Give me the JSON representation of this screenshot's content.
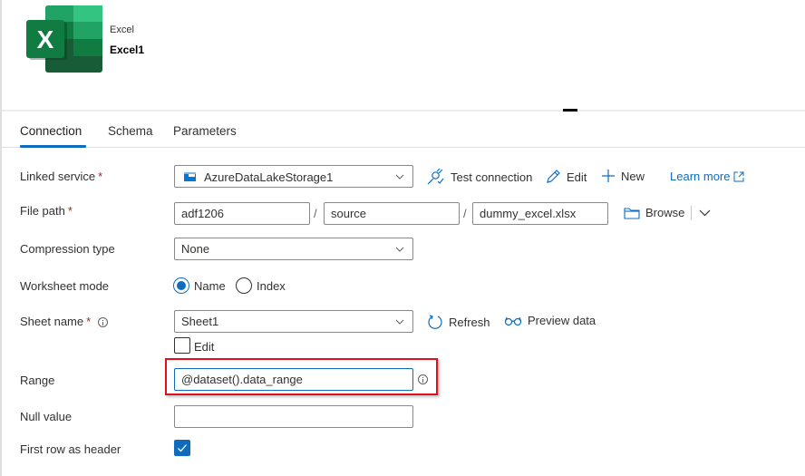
{
  "header": {
    "dataset_type": "Excel",
    "dataset_name": "Excel1",
    "icon": "excel-logo-icon"
  },
  "tabs": [
    {
      "label": "Connection",
      "active": true
    },
    {
      "label": "Schema",
      "active": false
    },
    {
      "label": "Parameters",
      "active": false
    }
  ],
  "form": {
    "linked_service": {
      "label": "Linked service",
      "required_mark": "*",
      "value": "AzureDataLakeStorage1",
      "icon": "storage-icon",
      "actions": {
        "test_connection": "Test connection",
        "edit": "Edit",
        "new": "New",
        "learn_more": "Learn more"
      }
    },
    "file_path": {
      "label": "File path",
      "required_mark": "*",
      "container": "adf1206",
      "directory": "source",
      "file": "dummy_excel.xlsx",
      "separator": "/",
      "browse": "Browse"
    },
    "compression_type": {
      "label": "Compression type",
      "value": "None"
    },
    "worksheet_mode": {
      "label": "Worksheet mode",
      "options": [
        {
          "label": "Name",
          "checked": true
        },
        {
          "label": "Index",
          "checked": false
        }
      ]
    },
    "sheet_name": {
      "label": "Sheet name",
      "required_mark": "*",
      "value": "Sheet1",
      "refresh": "Refresh",
      "preview": "Preview data",
      "edit_checkbox": {
        "label": "Edit",
        "checked": false
      }
    },
    "range": {
      "label": "Range",
      "value": "@dataset().data_range"
    },
    "null_value": {
      "label": "Null value",
      "value": ""
    },
    "first_row_header": {
      "label": "First row as header",
      "checked": true
    }
  },
  "colors": {
    "accent": "#0f6cbd",
    "highlight": "#e0101a",
    "excel_green": "#107c41"
  }
}
